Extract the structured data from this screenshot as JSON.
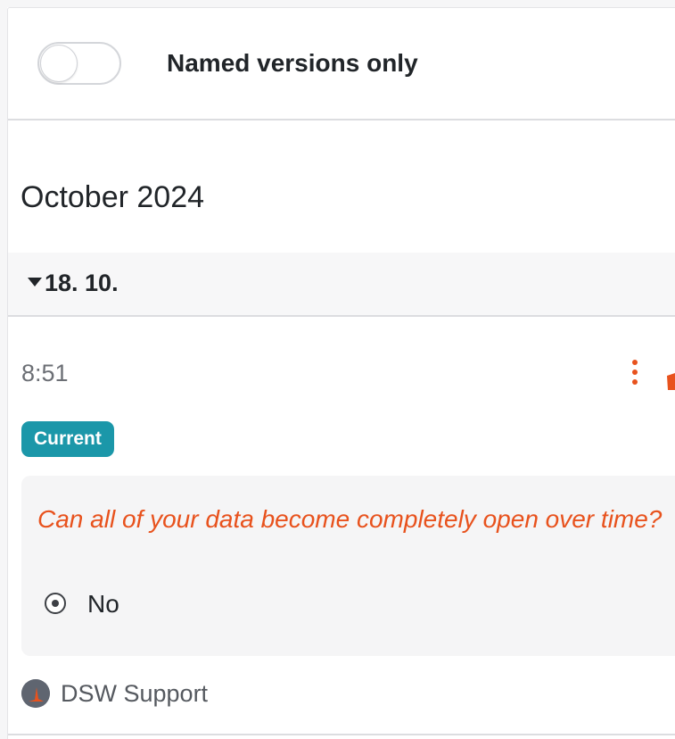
{
  "header": {
    "toggle_label": "Named versions only",
    "toggle_on": false
  },
  "month": {
    "title": "October 2024"
  },
  "day": {
    "label": "18. 10.",
    "expanded": true
  },
  "entry": {
    "time": "8:51",
    "badge": "Current",
    "change": {
      "question": "Can all of your data become completely open over time?",
      "answer": "No",
      "answer_selected": true
    },
    "author": {
      "name": "DSW Support"
    },
    "menu_icon": "more-vertical-icon"
  },
  "colors": {
    "accent": "#e8521d",
    "badge": "#1b97a9",
    "text": "#212529",
    "muted": "#6c6f75",
    "day_bg": "#f7f7f8",
    "card_bg": "#f5f5f6"
  }
}
